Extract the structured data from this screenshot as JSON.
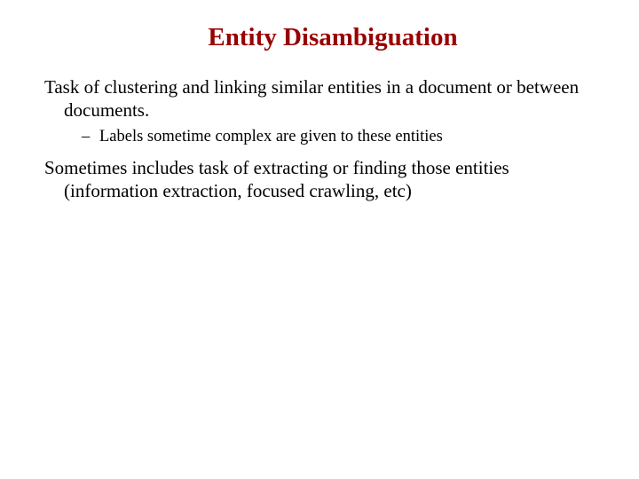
{
  "title": "Entity Disambiguation",
  "body": {
    "p1": "Task of clustering and linking similar entities in a document or between documents.",
    "sub1_dash": "–  ",
    "sub1": "Labels sometime complex are given to these entities",
    "p2": "Sometimes includes task of extracting or finding those entities (information extraction, focused crawling, etc)"
  }
}
